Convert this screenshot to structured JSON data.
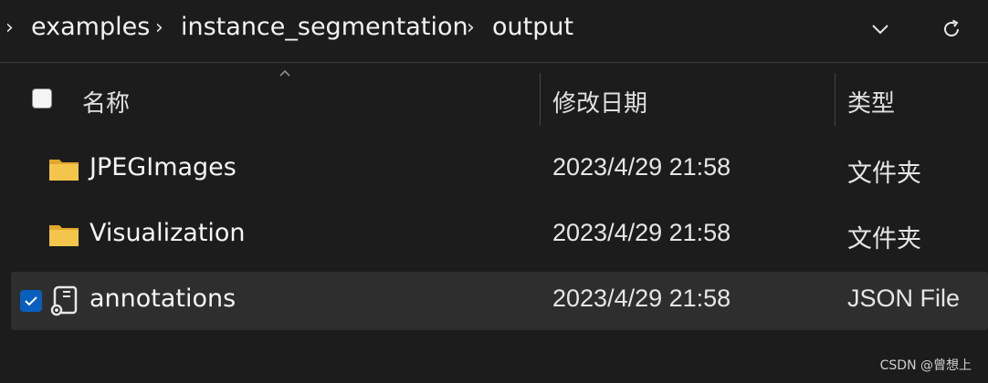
{
  "breadcrumb": {
    "items": [
      "examples",
      "instance_segmentation",
      "output"
    ]
  },
  "address_bar": {
    "dropdown_icon": "chevron-down-icon",
    "refresh_icon": "refresh-icon"
  },
  "columns": {
    "name": "名称",
    "modified": "修改日期",
    "type": "类型"
  },
  "files": [
    {
      "name": "JPEGImages",
      "modified": "2023/4/29 21:58",
      "type": "文件夹",
      "icon": "folder-icon",
      "selected": false
    },
    {
      "name": "Visualization",
      "modified": "2023/4/29 21:58",
      "type": "文件夹",
      "icon": "folder-icon",
      "selected": false
    },
    {
      "name": "annotations",
      "modified": "2023/4/29 21:58",
      "type": "JSON File",
      "icon": "json-file-icon",
      "selected": true
    }
  ],
  "colors": {
    "background": "#1c1c1c",
    "selected_row": "#2e2e2e",
    "accent": "#0a5ebd",
    "folder": "#f3c54a"
  },
  "watermark": "CSDN @曾想上"
}
